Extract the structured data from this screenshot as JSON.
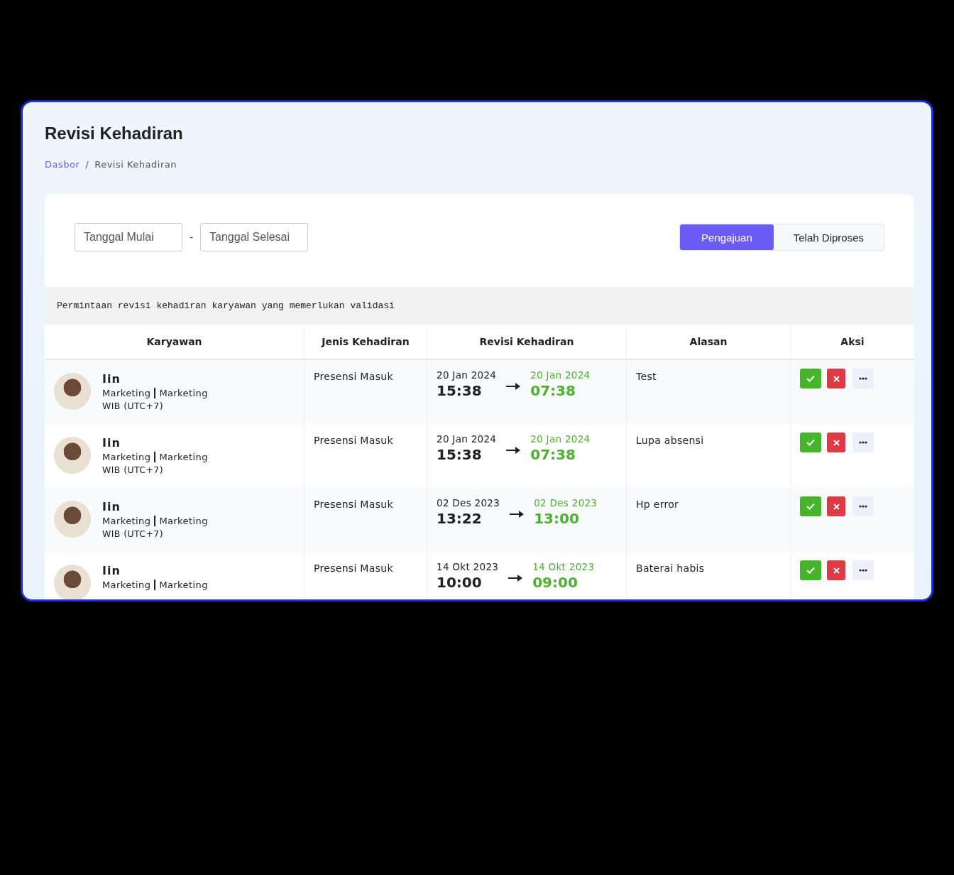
{
  "page": {
    "title": "Revisi Kehadiran",
    "breadcrumb_separator": "/",
    "breadcrumb": [
      {
        "label": "Dasbor",
        "link": true
      },
      {
        "label": "Revisi Kehadiran",
        "link": false
      }
    ]
  },
  "filters": {
    "start": {
      "placeholder": "Tanggal Mulai"
    },
    "separator": "-",
    "end": {
      "placeholder": "Tanggal Selesai"
    }
  },
  "tabs": [
    {
      "label": "Pengajuan",
      "selected": true
    },
    {
      "label": "Telah Diproses",
      "selected": false
    }
  ],
  "table": {
    "caption": "Permintaan revisi kehadiran karyawan yang memerlukan validasi",
    "columns": [
      "Karyawan",
      "Jenis Kehadiran",
      "Revisi Kehadiran",
      "Alasan",
      "Aksi"
    ],
    "rows": [
      {
        "name": "Iin",
        "division": "Marketing",
        "position": "Marketing",
        "timezone": "WIB (UTC+7)",
        "type": "Presensi Masuk",
        "old_date": "20 Jan 2024",
        "old_time": "15:38",
        "new_date": "20 Jan 2024",
        "new_time": "07:38",
        "reason": "Test"
      },
      {
        "name": "Iin",
        "division": "Marketing",
        "position": "Marketing",
        "timezone": "WIB (UTC+7)",
        "type": "Presensi Masuk",
        "old_date": "20 Jan 2024",
        "old_time": "15:38",
        "new_date": "20 Jan 2024",
        "new_time": "07:38",
        "reason": "Lupa absensi"
      },
      {
        "name": "Iin",
        "division": "Marketing",
        "position": "Marketing",
        "timezone": "WIB (UTC+7)",
        "type": "Presensi Masuk",
        "old_date": "02 Des 2023",
        "old_time": "13:22",
        "new_date": "02 Des 2023",
        "new_time": "13:00",
        "reason": "Hp error"
      },
      {
        "name": "Iin",
        "division": "Marketing",
        "position": "Marketing",
        "type": "Presensi Masuk",
        "old_date": "14 Okt 2023",
        "old_time": "10:00",
        "new_date": "14 Okt 2023",
        "new_time": "09:00",
        "reason": "Baterai habis"
      }
    ]
  }
}
